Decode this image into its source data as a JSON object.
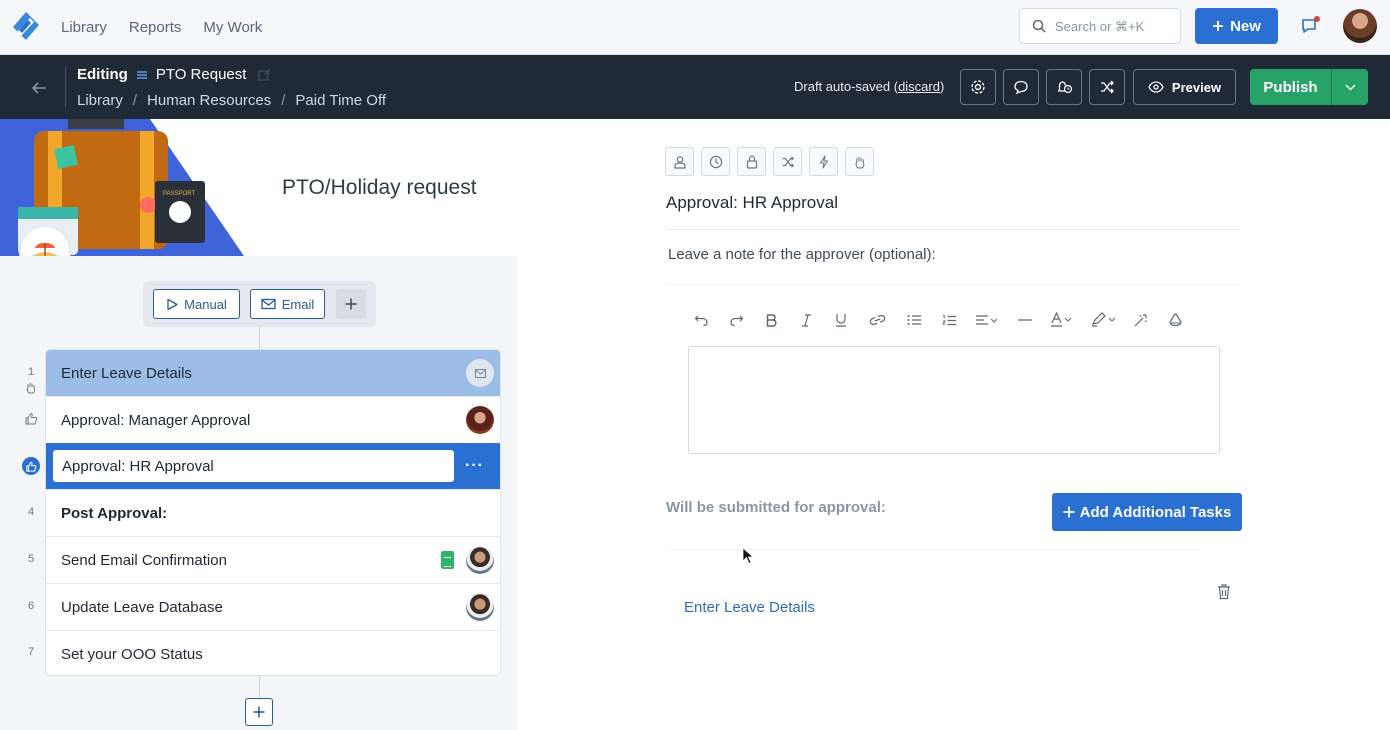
{
  "topnav": {
    "links": [
      "Library",
      "Reports",
      "My Work"
    ],
    "search_placeholder": "Search or ⌘+K",
    "new_label": "New"
  },
  "editor": {
    "editing_label": "Editing",
    "workflow_name": "PTO Request",
    "breadcrumbs": [
      "Library",
      "Human Resources",
      "Paid Time Off"
    ],
    "draft_text": "Draft auto-saved",
    "discard_label": "discard",
    "preview_label": "Preview",
    "publish_label": "Publish"
  },
  "left": {
    "hero_title": "PTO/Holiday request",
    "passport_text": "PASSPORT",
    "triggers": [
      "Manual",
      "Email"
    ],
    "steps": [
      {
        "num": "1",
        "label": "Enter Leave Details"
      },
      {
        "num": "",
        "label": "Approval: Manager Approval"
      },
      {
        "num": "",
        "label": "Approval: HR Approval"
      },
      {
        "num": "4",
        "label": "Post Approval:"
      },
      {
        "num": "5",
        "label": "Send Email Confirmation"
      },
      {
        "num": "6",
        "label": "Update Leave Database"
      },
      {
        "num": "7",
        "label": "Set your OOO Status"
      }
    ],
    "more_label": "···"
  },
  "right": {
    "step_title": "Approval: HR Approval",
    "note_label": "Leave a note for the approver (optional):",
    "submitted_label": "Will be submitted for approval:",
    "add_tasks_label": "Add Additional Tasks",
    "linked_task": "Enter Leave Details"
  },
  "colors": {
    "brand_blue": "#2a6fd1",
    "publish_green": "#27a36a",
    "editor_bar": "#1f2a36"
  }
}
